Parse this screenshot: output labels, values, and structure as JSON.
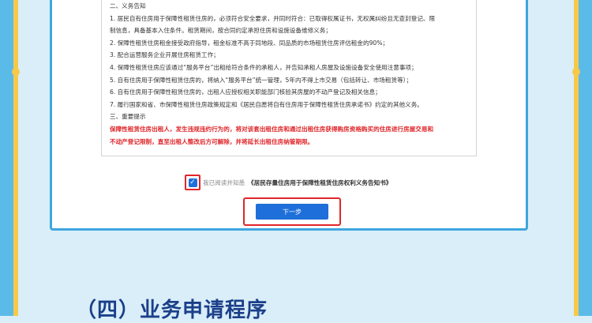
{
  "notice": {
    "lines": [
      {
        "text": "二、义务告知",
        "style": "heading"
      },
      {
        "text": "1. 居民自有住房用于保障性租赁住房的，必须符合安全要求，并同时符合：已取得权属证书，无权属纠纷且无查封登记、限",
        "style": "normal"
      },
      {
        "text": "制信息，具备基本入住条件。租赁期间，按合同约定承担住房和设施设备维修义务；",
        "style": "normal"
      },
      {
        "text": "2. 保障性租赁住房租金接受政府指导，租金标准不高于同地段、同品质的市场租赁住房评估租金的90%；",
        "style": "normal"
      },
      {
        "text": "3. 配合运营服务企业开展住房租赁工作；",
        "style": "normal"
      },
      {
        "text": "4. 保障性租赁住房应该通过“服务平台”出租给符合条件的承租人，并告知承租人房屋及设施设备安全使用注意事项；",
        "style": "normal"
      },
      {
        "text": "5. 自有住房用于保障性租赁住房的，将纳入“服务平台”统一管理，5年内不得上市交易（包括转让、市场租赁等）；",
        "style": "normal"
      },
      {
        "text": "6. 自有住房用于保障性租赁住房的，出租人应授权相关职能部门核验其房屋的不动产登记及相关信息；",
        "style": "normal"
      },
      {
        "text": "7. 履行国家和省、市保障性租赁住房政策规定和《居民自愿将自有住房用于保障性租赁住房承诺书》约定的其他义务。",
        "style": "normal"
      },
      {
        "text": "三、重要提示",
        "style": "heading"
      },
      {
        "text": "保障性租赁住房出租人，发生违规违约行为的，将对该套出租住房和通过出租住房获得购房资格购买的住房进行房屋交易和",
        "style": "warn"
      },
      {
        "text": "不动产登记限制，直至出租人整改后方可解除，并将延长出租住房纳管期限。",
        "style": "warn"
      }
    ]
  },
  "agreement": {
    "checked": true,
    "check_glyph": "✓",
    "label": "我已阅读并知悉",
    "document_title": "《居民存量住房用于保障性租赁住房权利义务告知书》"
  },
  "next_button": {
    "label": "下一步"
  },
  "section": {
    "title": "（四）业务申请程序"
  },
  "colors": {
    "accent_blue": "#1e6fd9",
    "frame_blue": "#3fa6de",
    "highlight_red": "#e0262a",
    "rail_yellow": "#f7c948",
    "title_navy": "#1b3f8a"
  }
}
